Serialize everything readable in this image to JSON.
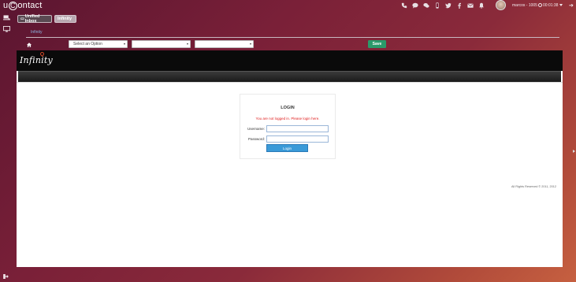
{
  "app": {
    "logo_prefix": "u",
    "logo_c": "C",
    "logo_suffix": "ontact"
  },
  "topbar": {
    "icons": [
      "phone-icon",
      "chat-icon",
      "sms-icon",
      "mobile-icon",
      "twitter-icon",
      "facebook-icon",
      "email-icon",
      "bell-icon"
    ],
    "user_label": "marcos - 1005",
    "timer": "00:01:38"
  },
  "tabs": {
    "inbox_label": "Unified Inbox",
    "infinity_label": "Infinity"
  },
  "breadcrumb": {
    "link": "Infinity"
  },
  "filters": {
    "select1": "Select an Option",
    "select2": "",
    "select3": "",
    "save_label": "Save"
  },
  "frame": {
    "logo_text": "Infinity",
    "login": {
      "title": "LOGIN",
      "error": "You are not logged in. Please login here.",
      "username_label": "Username:",
      "password_label": "Password:",
      "username_value": "",
      "password_value": "",
      "button": "Login"
    },
    "footer": "All Rights Reserved © 2011, 2012"
  }
}
